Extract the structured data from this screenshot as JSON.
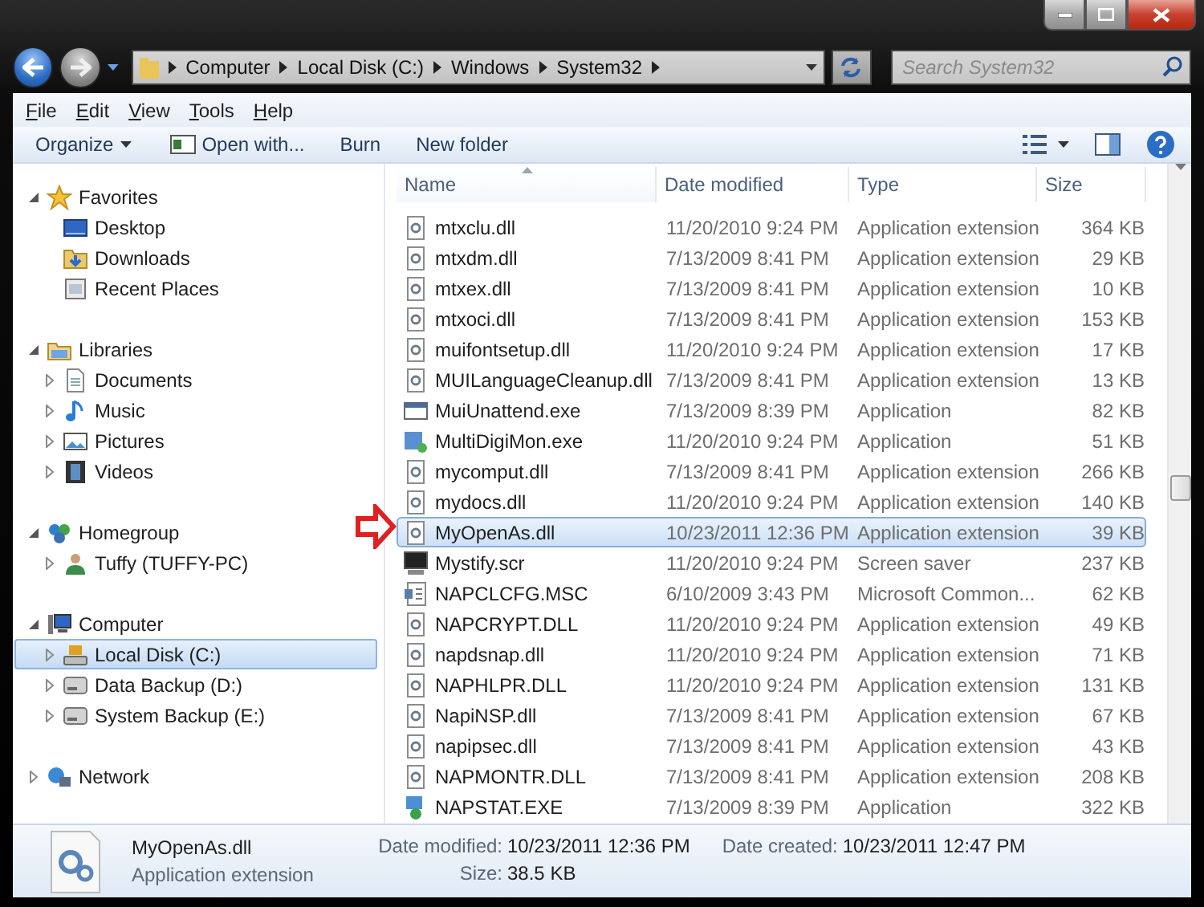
{
  "address_bar": {
    "breadcrumbs": [
      "Computer",
      "Local Disk (C:)",
      "Windows",
      "System32"
    ]
  },
  "search": {
    "placeholder": "Search System32"
  },
  "menu": [
    "File",
    "Edit",
    "View",
    "Tools",
    "Help"
  ],
  "toolbar": [
    {
      "label": "Organize",
      "kind": "menu"
    },
    {
      "label": "Open with...",
      "kind": "icon"
    },
    {
      "label": "Burn",
      "kind": "plain"
    },
    {
      "label": "New folder",
      "kind": "plain"
    }
  ],
  "nav_tree": [
    {
      "label": "Favorites",
      "kind": "star",
      "expanded": true,
      "children": [
        {
          "label": "Desktop",
          "kind": "desktop",
          "selected": false
        },
        {
          "label": "Downloads",
          "kind": "downloads",
          "selected": false
        },
        {
          "label": "Recent Places",
          "kind": "recent",
          "selected": false
        }
      ]
    },
    {
      "label": "Libraries",
      "kind": "library",
      "expanded": true,
      "children": [
        {
          "label": "Documents",
          "kind": "document",
          "expanded": false,
          "selected": false
        },
        {
          "label": "Music",
          "kind": "music",
          "expanded": false,
          "selected": false
        },
        {
          "label": "Pictures",
          "kind": "pictures",
          "expanded": false,
          "selected": false
        },
        {
          "label": "Videos",
          "kind": "videos",
          "expanded": false,
          "selected": false
        }
      ]
    },
    {
      "label": "Homegroup",
      "kind": "homegroup",
      "expanded": true,
      "children": [
        {
          "label": "Tuffy (TUFFY-PC)",
          "kind": "user",
          "expanded": false,
          "selected": false
        }
      ]
    },
    {
      "label": "Computer",
      "kind": "computer",
      "expanded": true,
      "children": [
        {
          "label": "Local Disk (C:)",
          "kind": "system-drive",
          "expanded": false,
          "selected": true
        },
        {
          "label": "Data Backup (D:)",
          "kind": "drive",
          "expanded": false,
          "selected": false
        },
        {
          "label": "System Backup (E:)",
          "kind": "drive",
          "expanded": false,
          "selected": false
        }
      ]
    },
    {
      "label": "Network",
      "kind": "network",
      "expanded": false
    }
  ],
  "file_list": {
    "columns": [
      {
        "label": "Name",
        "sorted": true
      },
      {
        "label": "Date modified",
        "sorted": false
      },
      {
        "label": "Type",
        "sorted": false
      },
      {
        "label": "Size",
        "sorted": false
      }
    ],
    "rows": [
      {
        "name": "mtxclu.dll",
        "date": "11/20/2010 9:24 PM",
        "type": "Application extension",
        "size": "364 KB",
        "kind": "dll",
        "selected": false
      },
      {
        "name": "mtxdm.dll",
        "date": "7/13/2009 8:41 PM",
        "type": "Application extension",
        "size": "29 KB",
        "kind": "dll",
        "selected": false
      },
      {
        "name": "mtxex.dll",
        "date": "7/13/2009 8:41 PM",
        "type": "Application extension",
        "size": "10 KB",
        "kind": "dll",
        "selected": false
      },
      {
        "name": "mtxoci.dll",
        "date": "7/13/2009 8:41 PM",
        "type": "Application extension",
        "size": "153 KB",
        "kind": "dll",
        "selected": false
      },
      {
        "name": "muifontsetup.dll",
        "date": "11/20/2010 9:24 PM",
        "type": "Application extension",
        "size": "17 KB",
        "kind": "dll",
        "selected": false
      },
      {
        "name": "MUILanguageCleanup.dll",
        "date": "7/13/2009 8:41 PM",
        "type": "Application extension",
        "size": "13 KB",
        "kind": "dll",
        "selected": false
      },
      {
        "name": "MuiUnattend.exe",
        "date": "7/13/2009 8:39 PM",
        "type": "Application",
        "size": "82 KB",
        "kind": "window",
        "selected": false
      },
      {
        "name": "MultiDigiMon.exe",
        "date": "11/20/2010 9:24 PM",
        "type": "Application",
        "size": "51 KB",
        "kind": "tool",
        "selected": false
      },
      {
        "name": "mycomput.dll",
        "date": "7/13/2009 8:41 PM",
        "type": "Application extension",
        "size": "266 KB",
        "kind": "dll",
        "selected": false
      },
      {
        "name": "mydocs.dll",
        "date": "11/20/2010 9:24 PM",
        "type": "Application extension",
        "size": "140 KB",
        "kind": "dll",
        "selected": false
      },
      {
        "name": "MyOpenAs.dll",
        "date": "10/23/2011 12:36 PM",
        "type": "Application extension",
        "size": "39 KB",
        "kind": "dll",
        "selected": true
      },
      {
        "name": "Mystify.scr",
        "date": "11/20/2010 9:24 PM",
        "type": "Screen saver",
        "size": "237 KB",
        "kind": "monitor",
        "selected": false
      },
      {
        "name": "NAPCLCFG.MSC",
        "date": "6/10/2009 3:43 PM",
        "type": "Microsoft Common...",
        "size": "62 KB",
        "kind": "console",
        "selected": false
      },
      {
        "name": "NAPCRYPT.DLL",
        "date": "11/20/2010 9:24 PM",
        "type": "Application extension",
        "size": "49 KB",
        "kind": "dll",
        "selected": false
      },
      {
        "name": "napdsnap.dll",
        "date": "11/20/2010 9:24 PM",
        "type": "Application extension",
        "size": "71 KB",
        "kind": "dll",
        "selected": false
      },
      {
        "name": "NAPHLPR.DLL",
        "date": "11/20/2010 9:24 PM",
        "type": "Application extension",
        "size": "131 KB",
        "kind": "dll",
        "selected": false
      },
      {
        "name": "NapiNSP.dll",
        "date": "7/13/2009 8:41 PM",
        "type": "Application extension",
        "size": "67 KB",
        "kind": "dll",
        "selected": false
      },
      {
        "name": "napipsec.dll",
        "date": "7/13/2009 8:41 PM",
        "type": "Application extension",
        "size": "43 KB",
        "kind": "dll",
        "selected": false
      },
      {
        "name": "NAPMONTR.DLL",
        "date": "7/13/2009 8:41 PM",
        "type": "Application extension",
        "size": "208 KB",
        "kind": "dll",
        "selected": false
      },
      {
        "name": "NAPSTAT.EXE",
        "date": "7/13/2009 8:39 PM",
        "type": "Application",
        "size": "322 KB",
        "kind": "network",
        "selected": false
      }
    ]
  },
  "details": {
    "name": "MyOpenAs.dll",
    "type": "Application extension",
    "fields": [
      {
        "label": "Date modified:",
        "value": "10/23/2011 12:36 PM"
      },
      {
        "label": "Size:",
        "value": "38.5 KB"
      },
      {
        "label": "Date created:",
        "value": "10/23/2011 12:47 PM"
      }
    ]
  }
}
